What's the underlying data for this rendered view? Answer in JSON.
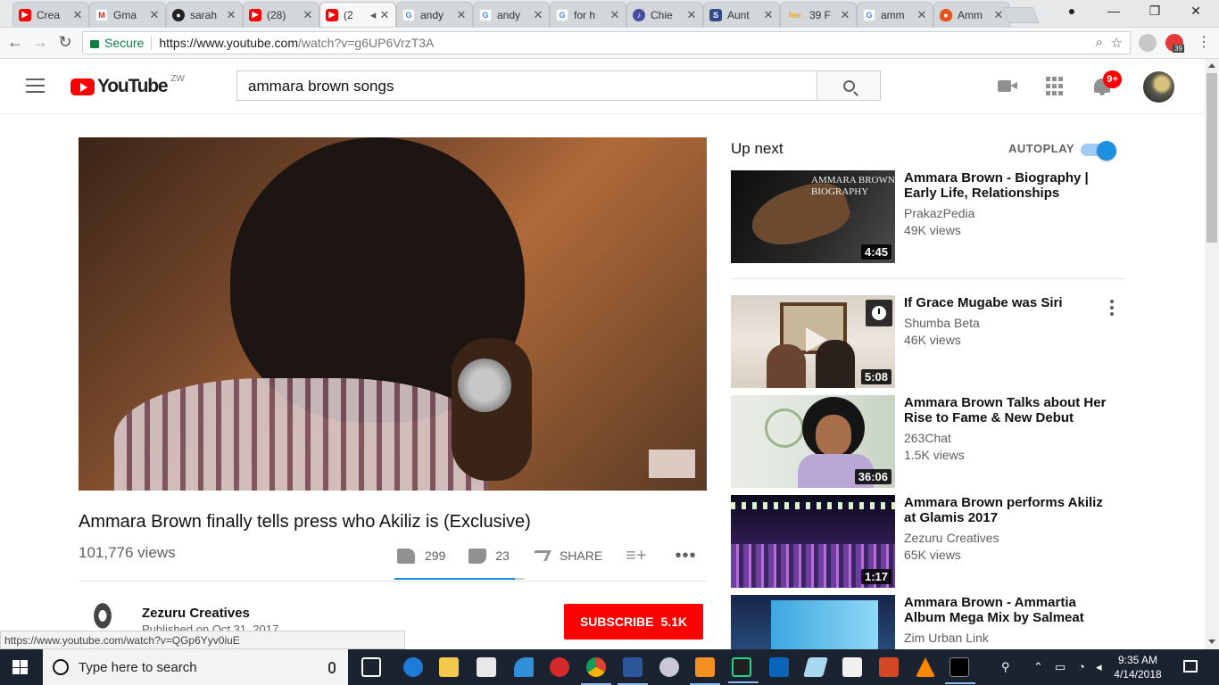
{
  "browser": {
    "tabs": [
      {
        "label": "Crea",
        "favicon": "youtube-icon",
        "color": "#ff0000"
      },
      {
        "label": "Gma",
        "favicon": "gmail-icon",
        "color": "#d93025"
      },
      {
        "label": "sarah",
        "favicon": "github-icon",
        "color": "#222222"
      },
      {
        "label": "(28) ",
        "favicon": "youtube-icon",
        "color": "#ff0000"
      },
      {
        "label": "(2",
        "favicon": "youtube-icon",
        "color": "#ff0000"
      },
      {
        "label": "andy",
        "favicon": "google-icon",
        "color": "#4285f4"
      },
      {
        "label": "andy",
        "favicon": "google-icon",
        "color": "#4285f4"
      },
      {
        "label": "for h",
        "favicon": "google-icon",
        "color": "#4285f4"
      },
      {
        "label": "Chie",
        "favicon": "guitar-icon",
        "color": "#4a4aa0"
      },
      {
        "label": "Aunt",
        "favicon": "s-icon",
        "color": "#334a8c"
      },
      {
        "label": "39 F",
        "favicon": "her-icon",
        "color": "#f0a81a"
      },
      {
        "label": "amm",
        "favicon": "google-icon",
        "color": "#4285f4"
      },
      {
        "label": "Amm",
        "favicon": "fire-icon",
        "color": "#e8541e"
      }
    ],
    "secure_label": "Secure",
    "url_host": "https://www.youtube.com",
    "url_path": "/watch?v=g6UP6VrzT3A",
    "ext_badge": "39",
    "status_url": "https://www.youtube.com/watch?v=QGp6Yyv0iuE"
  },
  "header": {
    "logo_text": "YouTube",
    "country": "ZW",
    "search_value": "ammara brown songs",
    "notification_count": "9+"
  },
  "video": {
    "title": "Ammara Brown finally tells press who Akiliz is (Exclusive)",
    "views": "101,776 views",
    "likes": "299",
    "dislikes": "23",
    "like_ratio": 0.929,
    "share_label": "SHARE",
    "more_label": "•••"
  },
  "channel": {
    "name": "Zezuru Creatives",
    "published": "Published on Oct 31, 2017",
    "subscribe_label": "SUBSCRIBE",
    "subscriber_count": "5.1K"
  },
  "sidebar": {
    "up_next": "Up next",
    "autoplay": "AUTOPLAY",
    "thumb1_text": "AMMARA BROWN",
    "thumb1_sub": "BIOGRAPHY",
    "items": [
      {
        "title": "Ammara Brown - Biography | Early Life, Relationships",
        "channel": "PrakazPedia",
        "views": "49K views",
        "duration": "4:45"
      },
      {
        "title": "If Grace Mugabe was Siri",
        "channel": "Shumba Beta",
        "views": "46K views",
        "duration": "5:08"
      },
      {
        "title": "Ammara Brown Talks about Her Rise to Fame & New Debut",
        "channel": "263Chat",
        "views": "1.5K views",
        "duration": "36:06"
      },
      {
        "title": "Ammara Brown performs Akiliz at Glamis 2017",
        "channel": "Zezuru Creatives",
        "views": "65K views",
        "duration": "1:17"
      },
      {
        "title": "Ammara Brown - Ammartia Album Mega Mix by Salmeat",
        "channel": "Zim Urban Link",
        "views": "",
        "duration": ""
      }
    ]
  },
  "taskbar": {
    "search_placeholder": "Type here to search",
    "time": "9:35 AM",
    "date": "4/14/2018"
  }
}
